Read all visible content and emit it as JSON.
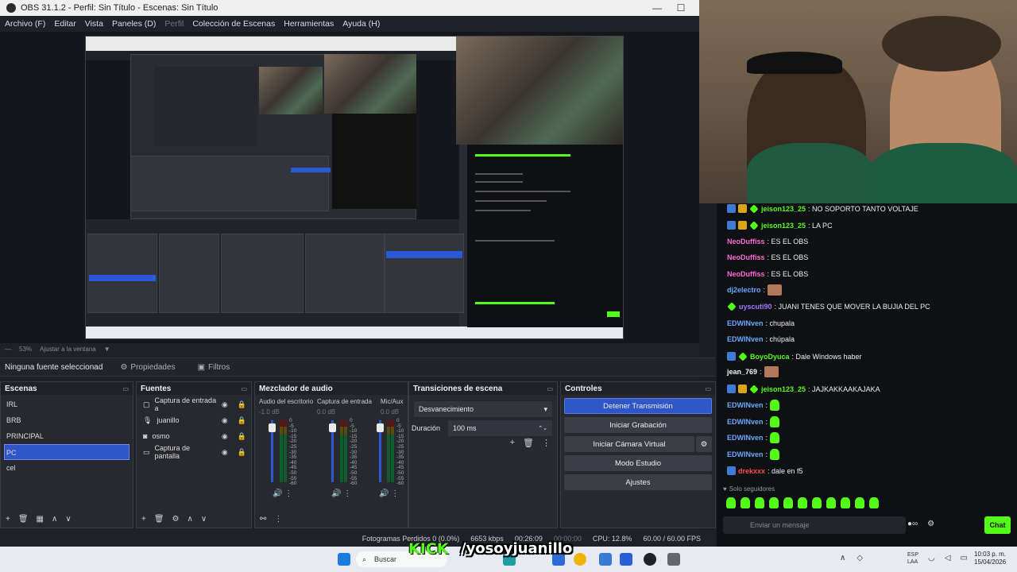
{
  "obs": {
    "title": "OBS 31.1.2 - Perfil: Sin Título - Escenas: Sin Título",
    "menu": [
      "Archivo (F)",
      "Editar",
      "Vista",
      "Paneles (D)",
      "Perfil",
      "Colección de Escenas",
      "Herramientas",
      "Ayuda (H)"
    ],
    "zoom": "53%",
    "zoom_mode": "Ajustar a la ventana",
    "no_source": "Ninguna fuente seleccionad",
    "properties": "Propiedades",
    "filters": "Filtros",
    "scenes_title": "Escenas",
    "scenes": [
      "IRL",
      "BRB",
      "PRINCIPAL",
      "PC",
      "cel"
    ],
    "sources_title": "Fuentes",
    "sources": [
      "Captura de entrada a",
      "juanillo",
      "osmo",
      "Captura de pantalla"
    ],
    "mixer_title": "Mezclador de audio",
    "mixer": [
      {
        "name": "Audio del escritorio",
        "db": "-1.0 dB"
      },
      {
        "name": "Captura de entrada",
        "db": "0.0 dB"
      },
      {
        "name": "Mic/Aux",
        "db": "0.0 dB"
      }
    ],
    "meter_scale": [
      "0",
      "-5",
      "-10",
      "-15",
      "-20",
      "-25",
      "-30",
      "-35",
      "-40",
      "-45",
      "-50",
      "-55",
      "-60"
    ],
    "transitions_title": "Transiciones de escena",
    "transition": "Desvanecimiento",
    "duration_label": "Duración",
    "duration": "100 ms",
    "controls_title": "Controles",
    "controls": [
      "Detener Transmisión",
      "Iniciar Grabación",
      "Iniciar Cámara Virtual",
      "Modo Estudio",
      "Ajustes"
    ],
    "status": {
      "frames": "Fotogramas Perdidos 0 (0.0%)",
      "bitrate": "6653 kbps",
      "live_time": "00:26:09",
      "rec_time": "00:00:00",
      "cpu": "CPU: 12.8%",
      "fps": "60.00 / 60.00 FPS"
    }
  },
  "chat": {
    "messages": [
      {
        "user": "jeison123_25",
        "text": ": NO SOPORTO TANTO VOLTAJE"
      },
      {
        "user": "jeison123_25",
        "text": ": LA PC"
      },
      {
        "user": "NeoDuffiss",
        "text": ": ES EL OBS"
      },
      {
        "user": "NeoDuffiss",
        "text": ": ES EL OBS"
      },
      {
        "user": "NeoDuffiss",
        "text": ": ES EL OBS"
      },
      {
        "user": "dj2electro",
        "text": ":"
      },
      {
        "user": "uyscuti90",
        "text": ": JUANI TENES QUE MOVER LA BUJIA DEL PC"
      },
      {
        "user": "EDWINven",
        "text": ": chupala"
      },
      {
        "user": "EDWINven",
        "text": ": chúpala"
      },
      {
        "user": "BoyoDyuca",
        "text": ": Dale Windows haber"
      },
      {
        "user": "jean_769",
        "text": ":"
      },
      {
        "user": "jeison123_25",
        "text": ": JAJKAKKAAKAJAKA"
      },
      {
        "user": "EDWINven",
        "text": ":"
      },
      {
        "user": "EDWINven",
        "text": ":"
      },
      {
        "user": "EDWINven",
        "text": ":"
      },
      {
        "user": "EDWINven",
        "text": ":"
      },
      {
        "user": "drekxxx",
        "text": ": dale en f5"
      }
    ],
    "followers_only": "Solo seguidores",
    "input_placeholder": "Enviar un mensaje",
    "send": "Chat"
  },
  "overlay": {
    "kick": "KICK",
    "handle": "/yosoyjuanillo"
  },
  "taskbar": {
    "search": "Buscar",
    "lang": "ESP",
    "lang2": "LAA",
    "time": "10:03 p. m.",
    "date": "15/04/2026"
  }
}
